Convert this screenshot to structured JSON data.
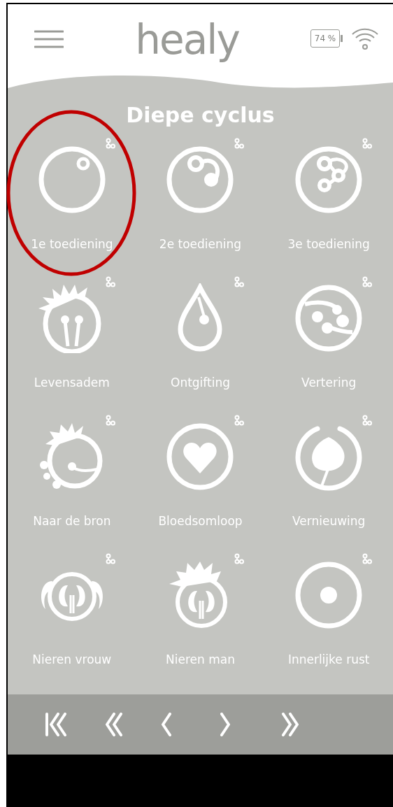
{
  "header": {
    "logo": "healy",
    "battery": "74 %"
  },
  "title": "Diepe cyclus",
  "items": [
    {
      "label": "1e toediening",
      "highlighted": true
    },
    {
      "label": "2e toediening",
      "highlighted": false
    },
    {
      "label": "3e toediening",
      "highlighted": false
    },
    {
      "label": "Levensadem",
      "highlighted": false
    },
    {
      "label": "Ontgifting",
      "highlighted": false
    },
    {
      "label": "Vertering",
      "highlighted": false
    },
    {
      "label": "Naar de bron",
      "highlighted": false
    },
    {
      "label": "Bloedsomloop",
      "highlighted": false
    },
    {
      "label": "Vernieuwing",
      "highlighted": false
    },
    {
      "label": "Nieren vrouw",
      "highlighted": false
    },
    {
      "label": "Nieren man",
      "highlighted": false
    },
    {
      "label": "Innerlijke rust",
      "highlighted": false
    }
  ]
}
